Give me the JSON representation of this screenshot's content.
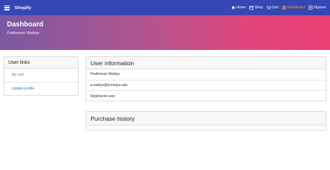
{
  "navbar": {
    "brand": "Shopify",
    "items": [
      {
        "label": "Home",
        "icon": "home-icon"
      },
      {
        "label": "Shop",
        "icon": "shop-icon"
      },
      {
        "label": "Cart",
        "icon": "cart-icon"
      },
      {
        "label": "Dashboard",
        "icon": "dashboard-icon",
        "active": true
      },
      {
        "label": "Signout",
        "icon": "signout-icon"
      }
    ],
    "active_color": "#f5a623",
    "background": "#3646b3"
  },
  "hero": {
    "title": "Dashboard",
    "subtitle": "Prathmesh Wadiya"
  },
  "user_links": {
    "title": "User links",
    "items": [
      {
        "label": "My cart"
      },
      {
        "label": "Update profile"
      }
    ]
  },
  "user_info": {
    "title": "User information",
    "rows": [
      "Prathmesh Wadiya",
      "p.wadiya@somaiya.edu",
      "Registered user"
    ]
  },
  "purchase_history": {
    "title": "Purchase history"
  }
}
